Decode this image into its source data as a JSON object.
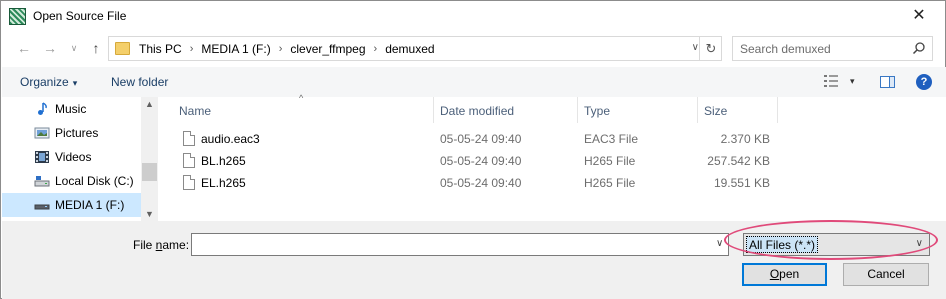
{
  "window": {
    "title": "Open Source File",
    "close_glyph": "✕"
  },
  "nav_buttons": {
    "back_glyph": "←",
    "forward_glyph": "→",
    "recent_glyph": "∨",
    "up_glyph": "↑"
  },
  "address": {
    "crumbs": [
      "This PC",
      "MEDIA 1 (F:)",
      "clever_ffmpeg",
      "demuxed"
    ],
    "separator": "›",
    "dropdown_glyph": "∨",
    "refresh_glyph": "↻"
  },
  "search": {
    "placeholder": "Search demuxed",
    "value": ""
  },
  "toolbar": {
    "organize_label": "Organize",
    "organize_caret": "▾",
    "new_folder_label": "New folder",
    "view_caret": "▾",
    "help_glyph": "?"
  },
  "navpane": {
    "items": [
      {
        "label": "Music",
        "icon": "music-icon"
      },
      {
        "label": "Pictures",
        "icon": "pictures-icon"
      },
      {
        "label": "Videos",
        "icon": "videos-icon"
      },
      {
        "label": "Local Disk (C:)",
        "icon": "local-disk-icon"
      },
      {
        "label": "MEDIA 1 (F:)",
        "icon": "drive-icon",
        "selected": true
      }
    ],
    "scroll_up": "▲",
    "scroll_down": "▼"
  },
  "filelist": {
    "sort_glyph": "^",
    "columns": {
      "name": "Name",
      "date": "Date modified",
      "type": "Type",
      "size": "Size"
    },
    "rows": [
      {
        "name": "audio.eac3",
        "date": "05-05-24 09:40",
        "type": "EAC3 File",
        "size": "2.370 KB"
      },
      {
        "name": "BL.h265",
        "date": "05-05-24 09:40",
        "type": "H265 File",
        "size": "257.542 KB"
      },
      {
        "name": "EL.h265",
        "date": "05-05-24 09:40",
        "type": "H265 File",
        "size": "19.551 KB"
      }
    ]
  },
  "bottom": {
    "file_name_label_pre": "File ",
    "file_name_label_u": "n",
    "file_name_label_post": "ame:",
    "file_name_value": "",
    "file_name_dropdown": "∨",
    "file_type_value": "All Files (*.*)",
    "file_type_caret": "∨",
    "open_label_u": "O",
    "open_label_rest": "pen",
    "cancel_label": "Cancel"
  },
  "colors": {
    "accent": "#0078d7",
    "selection": "#cce8ff",
    "highlight_ellipse": "#e04a7a"
  }
}
